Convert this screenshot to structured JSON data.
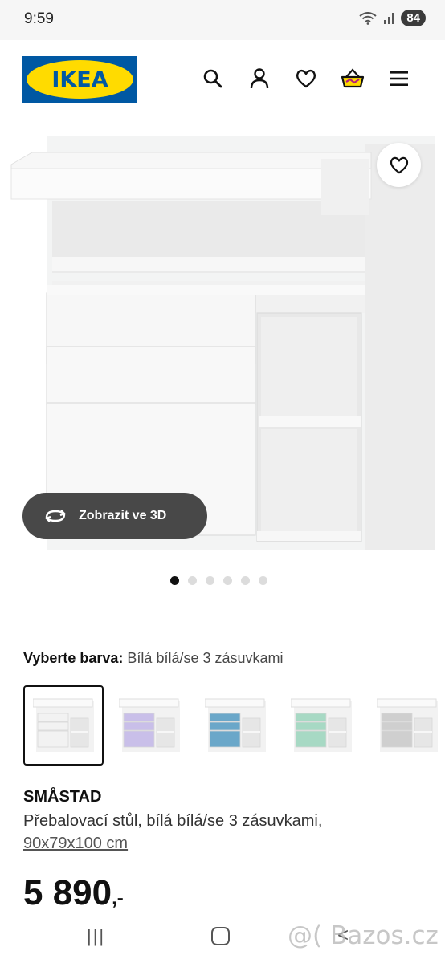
{
  "status_bar": {
    "time": "9:59",
    "battery": "84"
  },
  "header": {
    "logo_text": "IKEA",
    "icons": [
      "search-icon",
      "user-icon",
      "heart-icon",
      "cart-icon",
      "menu-icon"
    ]
  },
  "gallery": {
    "view_3d_label": "Zobrazit ve 3D",
    "dot_count": 6,
    "active_dot": 1
  },
  "color_select": {
    "label": "Vyberte barva:",
    "value": "Bílá bílá/se 3 zásuvkami",
    "options": [
      {
        "drawer_color": "#f2f2f2",
        "selected": true
      },
      {
        "drawer_color": "#c9bfe9",
        "selected": false
      },
      {
        "drawer_color": "#6aa7c9",
        "selected": false
      },
      {
        "drawer_color": "#a7d9c4",
        "selected": false
      },
      {
        "drawer_color": "#cfcfcf",
        "selected": false
      }
    ]
  },
  "product": {
    "name": "SMÅSTAD",
    "description": "Přebalovací stůl, bílá bílá/se 3 zásuvkami,",
    "size": "90x79x100 cm",
    "price": "5 890",
    "price_suffix": ",-"
  },
  "navbar": {
    "recent": "|||",
    "back": "<",
    "watermark": "@( Bazos.cz"
  },
  "colors": {
    "ikea_blue": "#0058a3",
    "ikea_yellow": "#ffdb00",
    "button_dark": "#484848"
  }
}
